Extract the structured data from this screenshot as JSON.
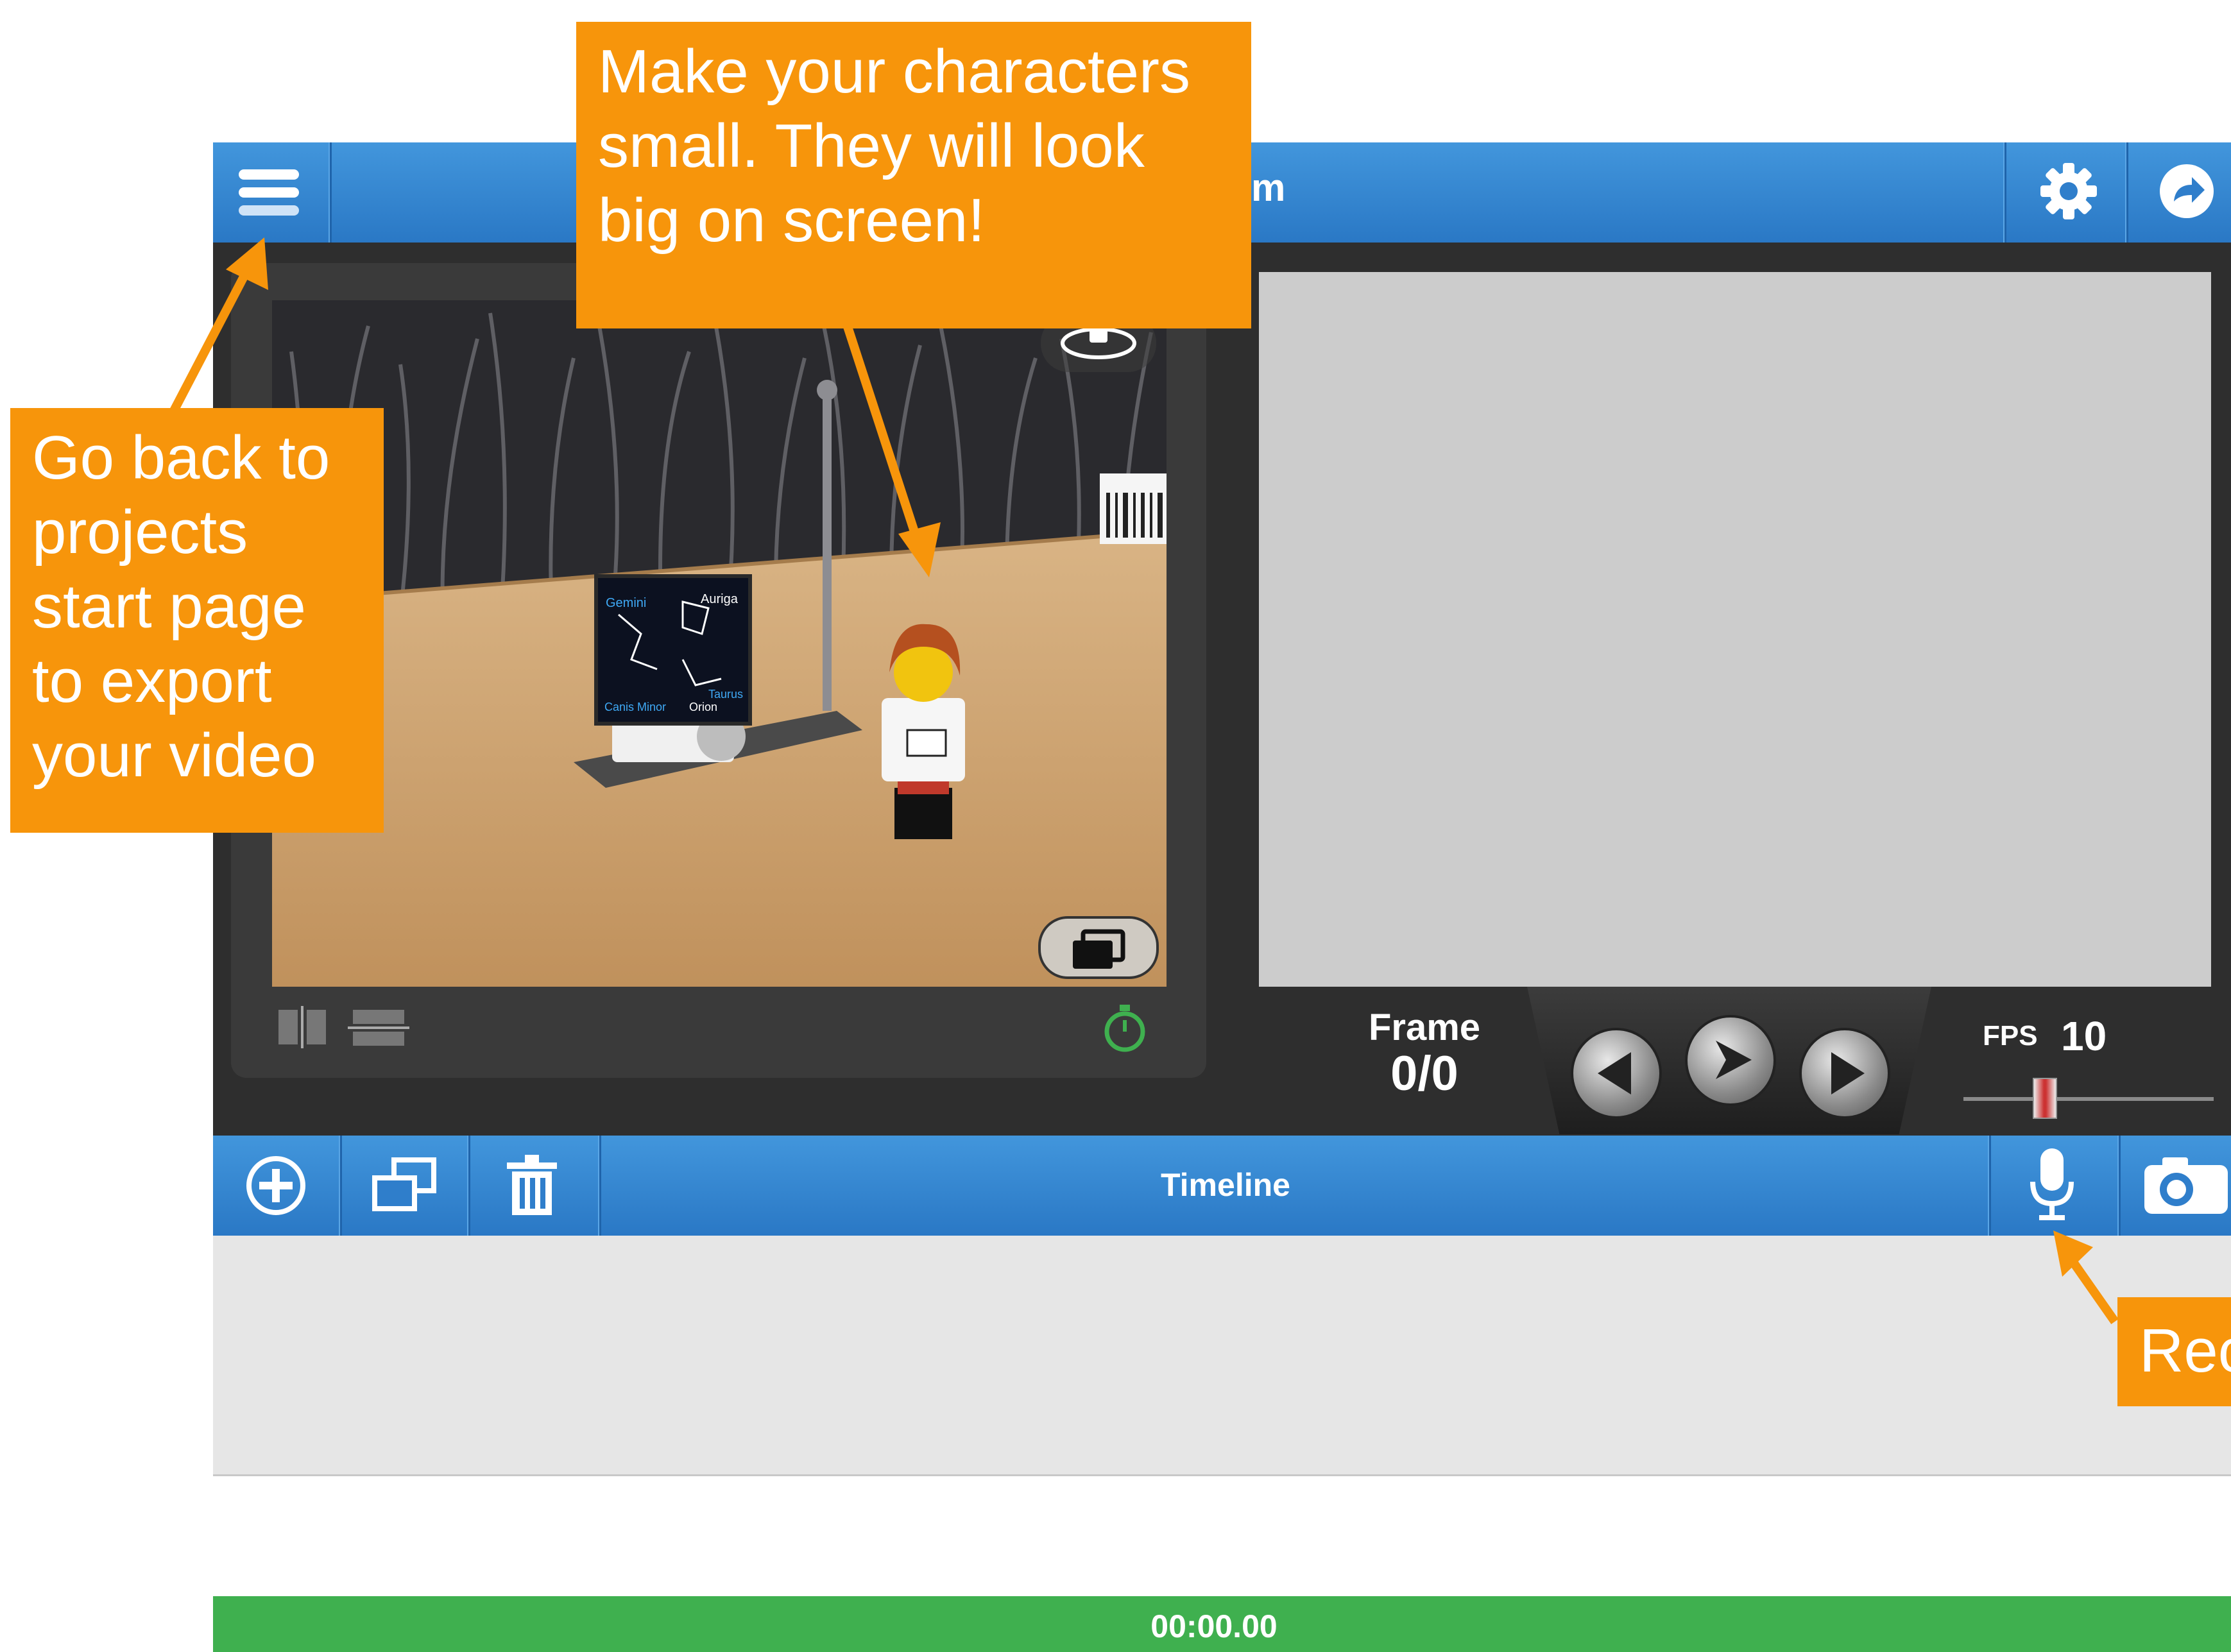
{
  "topbar": {
    "title_fragment": "m",
    "menu_icon": "hamburger-menu-icon",
    "settings_icon": "gear-icon",
    "share_icon": "share-arrow-icon"
  },
  "camera": {
    "constellations": [
      "Gemini",
      "Auriga",
      "Canis Minor",
      "Taurus",
      "Orion"
    ],
    "flip_icon": "camera-flip-icon",
    "overlay_icon": "onion-skin-icon",
    "timer_icon": "timer-icon"
  },
  "playback": {
    "frame_label": "Frame",
    "frame_count": "0/0",
    "fps_label": "FPS",
    "fps_value": "10"
  },
  "timeline": {
    "label": "Timeline",
    "time": "00:00.00"
  },
  "callouts": {
    "top": "Make your characters small. They will look big on screen!",
    "left": "Go back to projects start page to export your video",
    "right": "Rec"
  },
  "colors": {
    "bar_blue": "#3a8ad6",
    "callout_orange": "#f7950b",
    "time_green": "#3fb04f"
  }
}
